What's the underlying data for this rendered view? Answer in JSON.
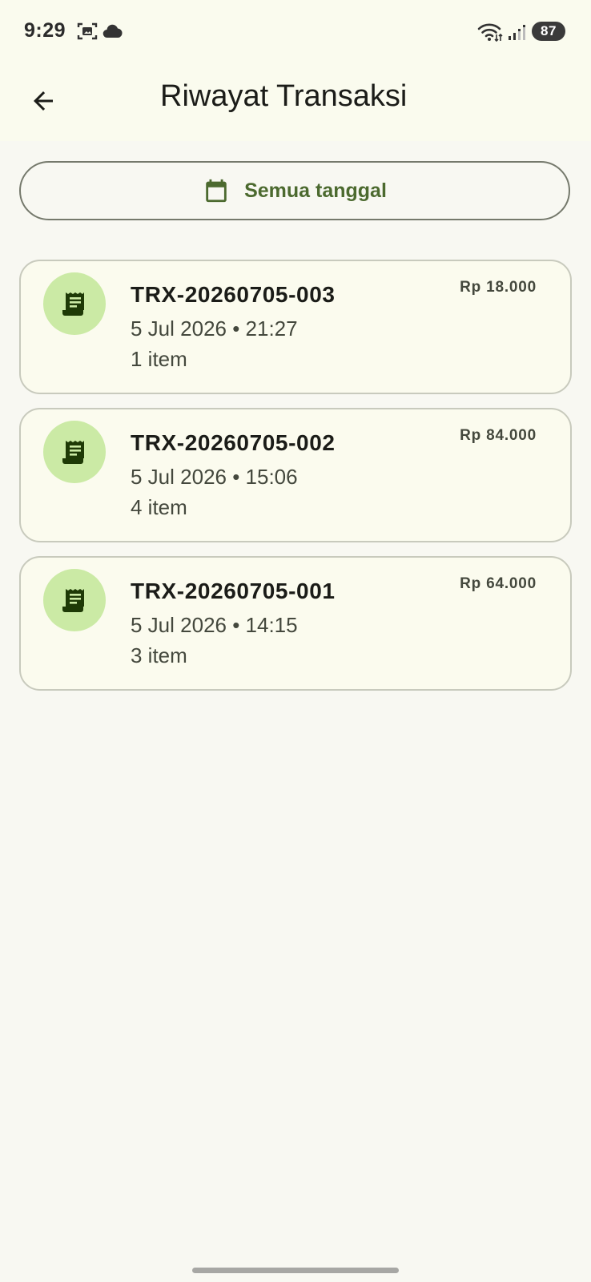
{
  "status_bar": {
    "time": "9:29",
    "battery": "87",
    "icons": [
      "screenshot-icon",
      "cloud-icon",
      "wifi-icon",
      "signal-icon"
    ]
  },
  "app_bar": {
    "back_icon": "arrow-back-icon",
    "title": "Riwayat Transaksi"
  },
  "filter": {
    "icon": "calendar-icon",
    "label": "Semua tanggal"
  },
  "transactions": [
    {
      "id": "TRX-20260705-003",
      "datetime": "5 Jul 2026 • 21:27",
      "items": "1 item",
      "amount": "Rp 18.000",
      "icon": "receipt-icon"
    },
    {
      "id": "TRX-20260705-002",
      "datetime": "5 Jul 2026 • 15:06",
      "items": "4 item",
      "amount": "Rp 84.000",
      "icon": "receipt-icon"
    },
    {
      "id": "TRX-20260705-001",
      "datetime": "5 Jul 2026 • 14:15",
      "items": "3 item",
      "amount": "Rp 64.000",
      "icon": "receipt-icon"
    }
  ],
  "colors": {
    "primary": "#4c6a2f",
    "avatar_bg": "#cbeaa5",
    "card_bg": "#fbfbee",
    "card_border": "#c8cabd",
    "header_bg": "#fafbee"
  }
}
